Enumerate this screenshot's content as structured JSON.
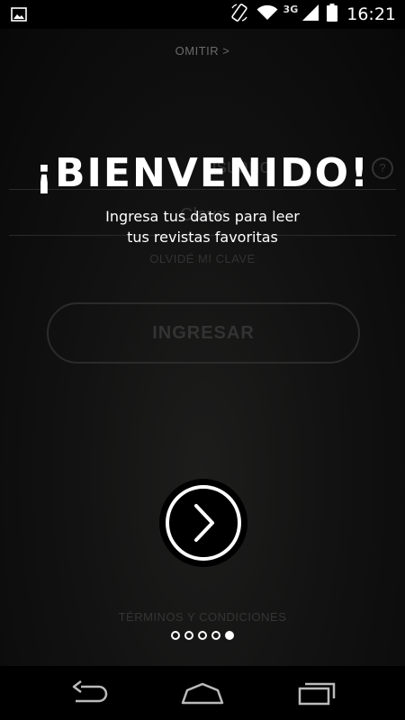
{
  "status_bar": {
    "notification_icon": "image-icon",
    "network_type": "3G",
    "time": "16:21",
    "icons": [
      "rotate-phone-icon",
      "wifi-icon",
      "signal-icon",
      "battery-icon"
    ]
  },
  "background": {
    "skip_label": "OMITIR >",
    "username_placeholder": "Usuario",
    "password_placeholder": "Clave",
    "help_symbol": "?",
    "forgot_label": "OLVIDÉ MI CLAVE",
    "login_label": "INGRESAR",
    "terms_label": "TÉRMINOS Y CONDICIONES"
  },
  "overlay": {
    "title": "¡BIENVENIDO!",
    "subtitle_line1": "Ingresa tus datos para leer",
    "subtitle_line2": "tus revistas favoritas",
    "next_icon": "chevron-right-icon"
  },
  "pagination": {
    "total": 5,
    "active_index": 4
  },
  "nav_bar": {
    "icons": [
      "back-icon",
      "home-icon",
      "recent-apps-icon"
    ]
  },
  "colors": {
    "background": "#000000",
    "text": "#ffffff",
    "dim_text": "#333333"
  }
}
